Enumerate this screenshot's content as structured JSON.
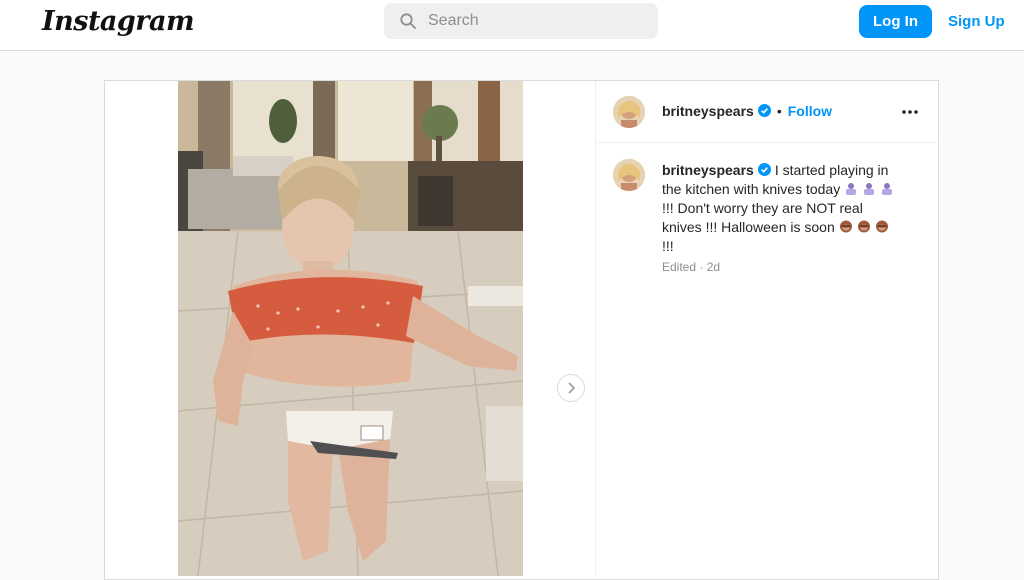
{
  "app": {
    "logo_text": "Instagram"
  },
  "search": {
    "placeholder": "Search"
  },
  "auth": {
    "login_label": "Log In",
    "signup_label": "Sign Up"
  },
  "post": {
    "username": "britneyspears",
    "separator": "•",
    "follow_label": "Follow",
    "caption_part1": "I started playing in the kitchen with knives today",
    "caption_part2": "!!! Don't worry they are NOT real knives !!! Halloween is soon",
    "caption_part3": "!!!",
    "edited_label": "Edited",
    "meta_separator": "·",
    "age": "2d"
  },
  "icons": {
    "search": "search-icon",
    "verified": "verified-badge-icon",
    "more": "more-options-icon",
    "next": "chevron-right-icon",
    "emoji_1": "person-emoji",
    "emoji_2": "see-no-evil-monkey-emoji"
  },
  "colors": {
    "accent": "#0095f6",
    "border": "#dbdbdb",
    "muted_text": "#8e8e8e",
    "background": "#fafafa"
  }
}
